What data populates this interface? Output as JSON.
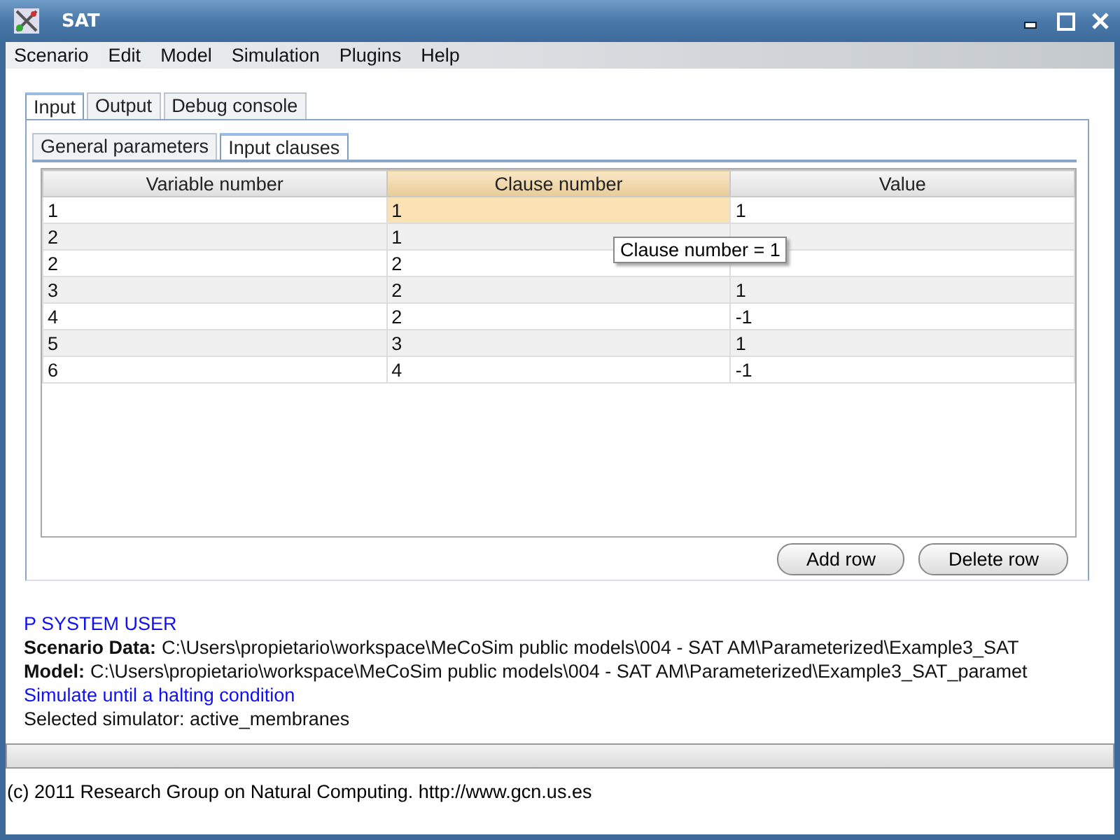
{
  "window": {
    "title": "SAT"
  },
  "menu": [
    "Scenario",
    "Edit",
    "Model",
    "Simulation",
    "Plugins",
    "Help"
  ],
  "tabs": [
    {
      "label": "Input",
      "selected": true
    },
    {
      "label": "Output",
      "selected": false
    },
    {
      "label": "Debug console",
      "selected": false
    }
  ],
  "subtabs": [
    {
      "label": "General parameters",
      "selected": false
    },
    {
      "label": "Input clauses",
      "selected": true
    }
  ],
  "table": {
    "columns": [
      {
        "label": "Variable number",
        "selected": false
      },
      {
        "label": "Clause number",
        "selected": true
      },
      {
        "label": "Value",
        "selected": false
      }
    ],
    "rows": [
      {
        "cells": [
          {
            "text": "1",
            "selected": false
          },
          {
            "text": "1",
            "selected": true
          },
          {
            "text": "1",
            "selected": false
          }
        ]
      },
      {
        "cells": [
          {
            "text": "2",
            "selected": false
          },
          {
            "text": "1",
            "selected": false
          },
          {
            "selected": false
          }
        ]
      },
      {
        "cells": [
          {
            "text": "2",
            "selected": false
          },
          {
            "text": "2",
            "selected": false
          },
          {
            "selected": false
          }
        ]
      },
      {
        "cells": [
          {
            "text": "3",
            "selected": false
          },
          {
            "text": "2",
            "selected": false
          },
          {
            "text": "1",
            "selected": false
          }
        ]
      },
      {
        "cells": [
          {
            "text": "4",
            "selected": false
          },
          {
            "text": "2",
            "selected": false
          },
          {
            "text": "-1",
            "selected": false
          }
        ]
      },
      {
        "cells": [
          {
            "text": "5",
            "selected": false
          },
          {
            "text": "3",
            "selected": false
          },
          {
            "text": "1",
            "selected": false
          }
        ]
      },
      {
        "cells": [
          {
            "text": "6",
            "selected": false
          },
          {
            "text": "4",
            "selected": false
          },
          {
            "text": "-1",
            "selected": false
          }
        ]
      }
    ]
  },
  "tooltip": "Clause number = 1",
  "buttons": [
    "Add row",
    "Delete row"
  ],
  "log": [
    {
      "kind": "info",
      "text": "P SYSTEM USER"
    },
    {
      "kind": "path",
      "label": "Scenario Data:",
      "text": "C:\\Users\\propietario\\workspace\\MeCoSim public models\\004 - SAT AM\\Parameterized\\Example3_SAT"
    },
    {
      "kind": "path",
      "label": "Model:",
      "text": "C:\\Users\\propietario\\workspace\\MeCoSim public models\\004 - SAT AM\\Parameterized\\Example3_SAT_paramet"
    },
    {
      "kind": "info",
      "text": "Simulate until a halting condition"
    },
    {
      "kind": "plain",
      "text": "Selected simulator: active_membranes"
    }
  ],
  "progress": {
    "level": 0
  },
  "footer": "(c) 2011 Research Group on Natural Computing. http://www.gcn.us.es"
}
